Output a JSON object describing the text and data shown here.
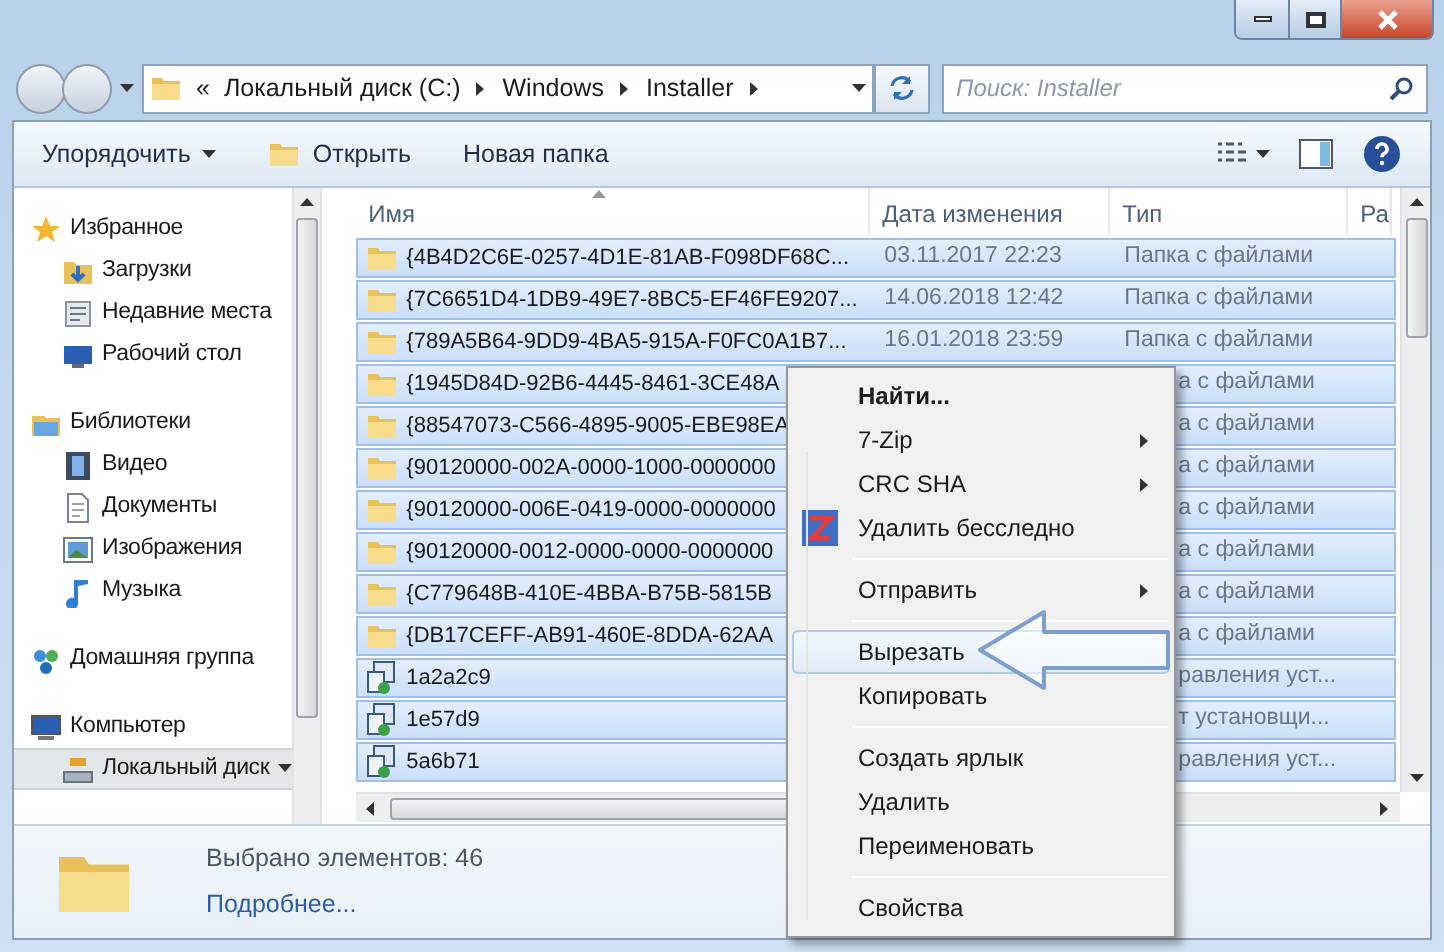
{
  "address": {
    "overflow": "«",
    "segments": [
      "Локальный диск (C:)",
      "Windows",
      "Installer"
    ]
  },
  "search": {
    "placeholder": "Поиск: Installer"
  },
  "toolbar": [
    {
      "label": "Упорядочить",
      "kind": "dropdown"
    },
    {
      "label": "Открыть",
      "kind": "open"
    },
    {
      "label": "Новая папка",
      "kind": "plain"
    }
  ],
  "sidebar": {
    "groups": [
      {
        "label": "Избранное",
        "kind": "star",
        "selected": false,
        "children": [
          {
            "label": "Загрузки",
            "kind": "downloads",
            "selected": false
          },
          {
            "label": "Недавние места",
            "kind": "recent",
            "selected": false
          },
          {
            "label": "Рабочий стол",
            "kind": "desktop",
            "selected": false
          }
        ]
      },
      {
        "label": "Библиотеки",
        "kind": "library",
        "selected": false,
        "children": [
          {
            "label": "Видео",
            "kind": "video",
            "selected": false
          },
          {
            "label": "Документы",
            "kind": "document",
            "selected": false
          },
          {
            "label": "Изображения",
            "kind": "image",
            "selected": false
          },
          {
            "label": "Музыка",
            "kind": "music",
            "selected": false
          }
        ]
      },
      {
        "label": "Домашняя группа",
        "kind": "homegroup",
        "selected": false
      },
      {
        "label": "Компьютер",
        "kind": "computer",
        "selected": false,
        "children": [
          {
            "label": "Локальный диск",
            "kind": "drive",
            "selected": true
          }
        ]
      }
    ]
  },
  "table": {
    "columns": [
      {
        "label": "Имя",
        "sorted": true
      },
      {
        "label": "Дата изменения",
        "sorted": false
      },
      {
        "label": "Тип",
        "sorted": false
      },
      {
        "label": "Ра",
        "sorted": false
      }
    ],
    "rows": [
      {
        "kind": "folder",
        "name": "{4B4D2C6E-0257-4D1E-81AB-F098DF68C...",
        "date": "03.11.2017 22:23",
        "type": "Папка с файлами",
        "selected": true
      },
      {
        "kind": "folder",
        "name": "{7C6651D4-1DB9-49E7-8BC5-EF46FE9207...",
        "date": "14.06.2018 12:42",
        "type": "Папка с файлами",
        "selected": true
      },
      {
        "kind": "folder",
        "name": "{789A5B64-9DD9-4BA5-915A-F0FC0A1B7...",
        "date": "16.01.2018 23:59",
        "type": "Папка с файлами",
        "selected": true
      },
      {
        "kind": "folder",
        "name": "{1945D84D-92B6-4445-8461-3CE48A",
        "type": "а с файлами",
        "selected": true
      },
      {
        "kind": "folder",
        "name": "{88547073-C566-4895-9005-EBE98EA",
        "type": "а с файлами",
        "selected": true
      },
      {
        "kind": "folder",
        "name": "{90120000-002A-0000-1000-0000000",
        "type": "а с файлами",
        "selected": true
      },
      {
        "kind": "folder",
        "name": "{90120000-006E-0419-0000-0000000",
        "type": "а с файлами",
        "selected": true
      },
      {
        "kind": "folder",
        "name": "{90120000-0012-0000-0000-0000000",
        "type": "а с файлами",
        "selected": true
      },
      {
        "kind": "folder",
        "name": "{C779648B-410E-4BBA-B75B-5815B",
        "type": "а с файлами",
        "selected": true
      },
      {
        "kind": "folder",
        "name": "{DB17CEFF-AB91-460E-8DDA-62AA",
        "type": "а с файлами",
        "selected": true
      },
      {
        "kind": "installer",
        "name": "1a2a2c9",
        "type": "равления уст...",
        "selected": true
      },
      {
        "kind": "installer",
        "name": "1e57d9",
        "type": "т установщи...",
        "selected": true
      },
      {
        "kind": "installer",
        "name": "5a6b71",
        "type": "равления уст...",
        "selected": true
      }
    ]
  },
  "context_menu": [
    {
      "kind": "item",
      "label": "Найти...",
      "bold": true,
      "submenu": false,
      "selected": false
    },
    {
      "kind": "item",
      "label": "7-Zip",
      "bold": false,
      "submenu": true,
      "selected": false
    },
    {
      "kind": "item",
      "label": "CRC SHA",
      "bold": false,
      "submenu": true,
      "selected": false
    },
    {
      "kind": "tool",
      "label": "Удалить бесследно",
      "bold": false,
      "submenu": false,
      "selected": false
    },
    {
      "kind": "separator"
    },
    {
      "kind": "item",
      "label": "Отправить",
      "bold": false,
      "submenu": true,
      "selected": false
    },
    {
      "kind": "separator"
    },
    {
      "kind": "item",
      "label": "Вырезать",
      "bold": false,
      "submenu": false,
      "selected": true
    },
    {
      "kind": "item",
      "label": "Копировать",
      "bold": false,
      "submenu": false,
      "selected": false
    },
    {
      "kind": "separator"
    },
    {
      "kind": "item",
      "label": "Создать ярлык",
      "bold": false,
      "submenu": false,
      "selected": false
    },
    {
      "kind": "item",
      "label": "Удалить",
      "bold": false,
      "submenu": false,
      "selected": false
    },
    {
      "kind": "item",
      "label": "Переименовать",
      "bold": false,
      "submenu": false,
      "selected": false
    },
    {
      "kind": "separator"
    },
    {
      "kind": "item",
      "label": "Свойства",
      "bold": false,
      "submenu": false,
      "selected": false
    }
  ],
  "status_bar": {
    "selection": "Выбрано элементов: 46",
    "link": "Подробнее..."
  }
}
